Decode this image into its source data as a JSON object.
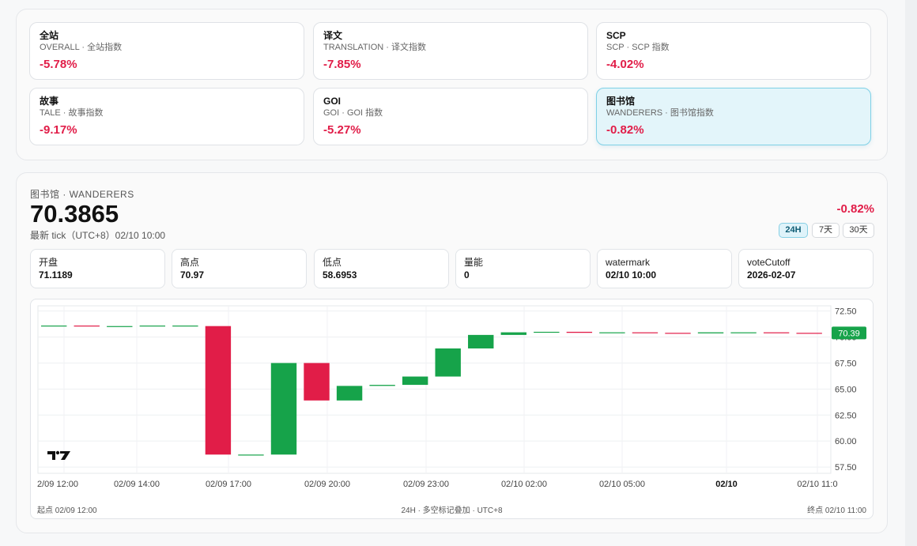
{
  "indices": [
    {
      "title": "全站",
      "subtitle": "OVERALL · 全站指数",
      "change": "-5.78%"
    },
    {
      "title": "译文",
      "subtitle": "TRANSLATION · 译文指数",
      "change": "-7.85%"
    },
    {
      "title": "SCP",
      "subtitle": "SCP · SCP 指数",
      "change": "-4.02%"
    },
    {
      "title": "故事",
      "subtitle": "TALE · 故事指数",
      "change": "-9.17%"
    },
    {
      "title": "GOI",
      "subtitle": "GOI · GOI 指数",
      "change": "-5.27%"
    },
    {
      "title": "图书馆",
      "subtitle": "WANDERERS · 图书馆指数",
      "change": "-0.82%",
      "active": true
    }
  ],
  "detail": {
    "name": "图书馆 · WANDERERS",
    "value": "70.3865",
    "tick": "最新 tick（UTC+8）02/10 10:00",
    "change": "-0.82%",
    "timeframes": [
      "24H",
      "7天",
      "30天"
    ],
    "selected_timeframe": "24H",
    "stats": [
      {
        "label": "开盘",
        "value": "71.1189"
      },
      {
        "label": "高点",
        "value": "70.97"
      },
      {
        "label": "低点",
        "value": "58.6953"
      },
      {
        "label": "量能",
        "value": "0"
      },
      {
        "label": "watermark",
        "value": "02/10 10:00"
      },
      {
        "label": "voteCutoff",
        "value": "2026-02-07"
      }
    ]
  },
  "chart_data": {
    "type": "candlestick",
    "y_ticks": [
      "72.50",
      "70.00",
      "67.50",
      "65.00",
      "62.50",
      "60.00",
      "57.50"
    ],
    "x_ticks": [
      "2/09 12:00",
      "02/09 14:00",
      "02/09 17:00",
      "02/09 20:00",
      "02/09 23:00",
      "02/10 02:00",
      "02/10 05:00",
      "02/10",
      "02/10 11:0"
    ],
    "last_price_label": "70.39",
    "last_price": 70.39,
    "candles": [
      {
        "open": 71.1,
        "close": 71.1
      },
      {
        "open": 71.1,
        "close": 71.05
      },
      {
        "open": 71.05,
        "close": 71.05
      },
      {
        "open": 71.05,
        "close": 71.1
      },
      {
        "open": 71.1,
        "close": 71.1
      },
      {
        "open": 71.05,
        "close": 58.7
      },
      {
        "open": 58.7,
        "close": 58.7
      },
      {
        "open": 58.7,
        "close": 67.5
      },
      {
        "open": 67.5,
        "close": 63.9
      },
      {
        "open": 63.9,
        "close": 65.3
      },
      {
        "open": 65.3,
        "close": 65.4
      },
      {
        "open": 65.4,
        "close": 66.2
      },
      {
        "open": 66.2,
        "close": 68.9
      },
      {
        "open": 68.9,
        "close": 70.2
      },
      {
        "open": 70.2,
        "close": 70.45
      },
      {
        "open": 70.45,
        "close": 70.5
      },
      {
        "open": 70.5,
        "close": 70.4
      },
      {
        "open": 70.4,
        "close": 70.45
      },
      {
        "open": 70.45,
        "close": 70.4
      },
      {
        "open": 70.4,
        "close": 70.35
      },
      {
        "open": 70.35,
        "close": 70.45
      },
      {
        "open": 70.45,
        "close": 70.45
      },
      {
        "open": 70.45,
        "close": 70.4
      },
      {
        "open": 70.4,
        "close": 70.39
      }
    ],
    "footer_left": "起点 02/09 12:00",
    "footer_center": "24H · 多空标记叠加 · UTC+8",
    "footer_right": "终点 02/10 11:00",
    "up_color": "#16a34a",
    "down_color": "#e11d48"
  }
}
